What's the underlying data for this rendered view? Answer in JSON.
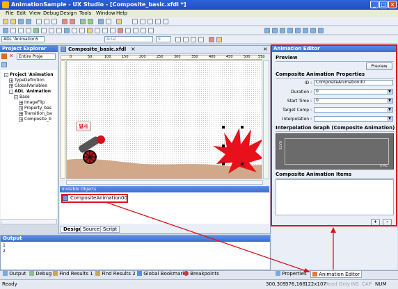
{
  "window": {
    "title": "AnimationSample - UX Studio - [Composite_basic.xfdl *]"
  },
  "menu": [
    "File",
    "Edit",
    "View",
    "Debug",
    "Design",
    "Tools",
    "Window",
    "Help"
  ],
  "toolbar": {
    "form_combo": "ADL 'AnimationS",
    "font_combo": "Arial",
    "size_combo": "9"
  },
  "project_explorer": {
    "title": "Project Explorer",
    "filter_value": "Entire Proje",
    "tree": [
      {
        "label": "Project 'Animation",
        "bold": true
      },
      {
        "label": "TypeDefinition"
      },
      {
        "label": "GlobalVariables"
      },
      {
        "label": "ADL 'Animation",
        "bold": true
      },
      {
        "label": "Base"
      },
      {
        "label": "ImageFlip"
      },
      {
        "label": "Property_bas"
      },
      {
        "label": "Transition_ba"
      },
      {
        "label": "Composite_b"
      }
    ]
  },
  "editor": {
    "tab": "Composite_basic.xfdl",
    "close_glyph": "×",
    "ruler_marks": [
      "0",
      "50",
      "100",
      "150",
      "200",
      "250",
      "300",
      "350",
      "400",
      "450",
      "500",
      "550"
    ],
    "fire_button": "발사",
    "invisible_objects_title": "Invisible Objects",
    "invisible_item": "CompositeAnimation00",
    "tabs": [
      "Design",
      "Source",
      "Script"
    ]
  },
  "output": {
    "title": "Output",
    "line_numbers": [
      "1",
      "2"
    ],
    "tabs": [
      "Output",
      "Debug",
      "Find Results 1",
      "Find Results 2",
      "Global Bookmark",
      "Breakpoints"
    ]
  },
  "animation_editor": {
    "title": "Animation Editor",
    "preview_label": "Preview",
    "preview_button": "Preview",
    "properties_title": "Composite Animation Properties",
    "fields": [
      {
        "label": "ID :",
        "value": "CompositeAnimation00",
        "dropdown": false
      },
      {
        "label": "Duration :",
        "value": "0",
        "dropdown": true
      },
      {
        "label": "Start Time :",
        "value": "0",
        "dropdown": true
      },
      {
        "label": "Target Comp :",
        "value": "",
        "dropdown": true
      },
      {
        "label": "Interpolation :",
        "value": "",
        "dropdown": true
      }
    ],
    "graph_title": "Interpolation Graph (Composite Animation)",
    "graph_axis_y": "RATE",
    "graph_axis_x": "TIME",
    "items_title": "Composite Animation Items",
    "add_button": "+",
    "remove_button": "-",
    "bottom_tabs": [
      "Properties",
      "Animation Editor"
    ]
  },
  "status": {
    "left": "Ready",
    "coords": "300,309",
    "coords2": "376,168",
    "size": "122x107",
    "readonly": "Read Only",
    "ins": "INS",
    "cap": "CAP",
    "num": "NUM"
  },
  "colors": {
    "title_bar": "#2d63d8",
    "panel_head": "#3a6fd0",
    "highlight": "#e0101c",
    "explosion": "#e8101a"
  }
}
